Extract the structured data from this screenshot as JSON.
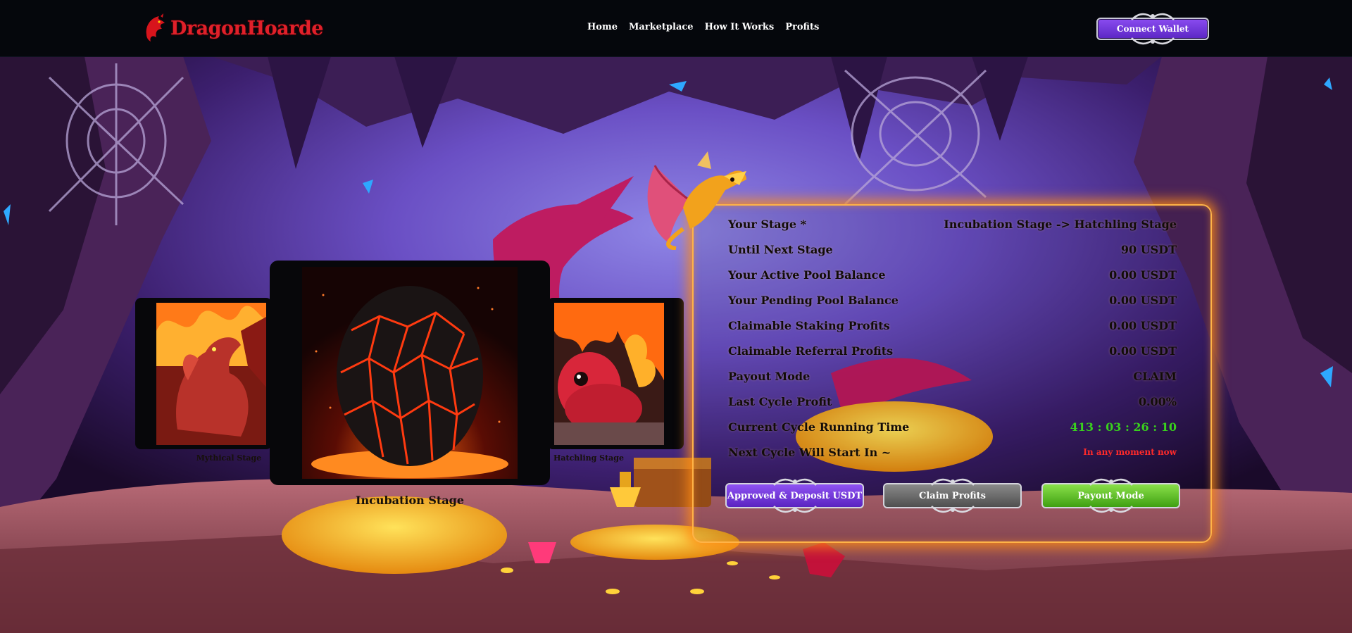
{
  "nav": {
    "logo_text": "DragonHoarde",
    "links": [
      "Home",
      "Marketplace",
      "How It Works",
      "Profits"
    ],
    "wallet_button": "Connect Wallet"
  },
  "carousel": {
    "left_label": "Mythical Stage",
    "center_label": "Incubation Stage",
    "right_label": "Hatchling Stage"
  },
  "stats": {
    "rows": [
      {
        "label": "Your Stage *",
        "value": "Incubation Stage -> Hatchling Stage"
      },
      {
        "label": "Until Next Stage",
        "value": "90 USDT"
      },
      {
        "label": "Your Active Pool Balance",
        "value": "0.00 USDT"
      },
      {
        "label": "Your Pending Pool Balance",
        "value": "0.00 USDT"
      },
      {
        "label": "Claimable Staking Profits",
        "value": "0.00 USDT"
      },
      {
        "label": "Claimable Referral Profits",
        "value": "0.00 USDT"
      },
      {
        "label": "Payout Mode",
        "value": "CLAIM"
      },
      {
        "label": "Last Cycle Profit",
        "value": "0.00%"
      },
      {
        "label": "Current Cycle Running Time",
        "value": "413 : 03 : 26 : 10"
      },
      {
        "label": "Next Cycle Will Start In ~",
        "value": "In any moment now"
      }
    ]
  },
  "buttons": {
    "deposit": "Approved & Deposit USDT",
    "claim": "Claim Profits",
    "payout": "Payout Mode"
  },
  "colors": {
    "brand_red": "#e0202a",
    "accent_purple": "#6d35d8",
    "panel_glow": "#ffa030",
    "timer_green": "#39d01d",
    "status_red": "#ff2a2a"
  }
}
